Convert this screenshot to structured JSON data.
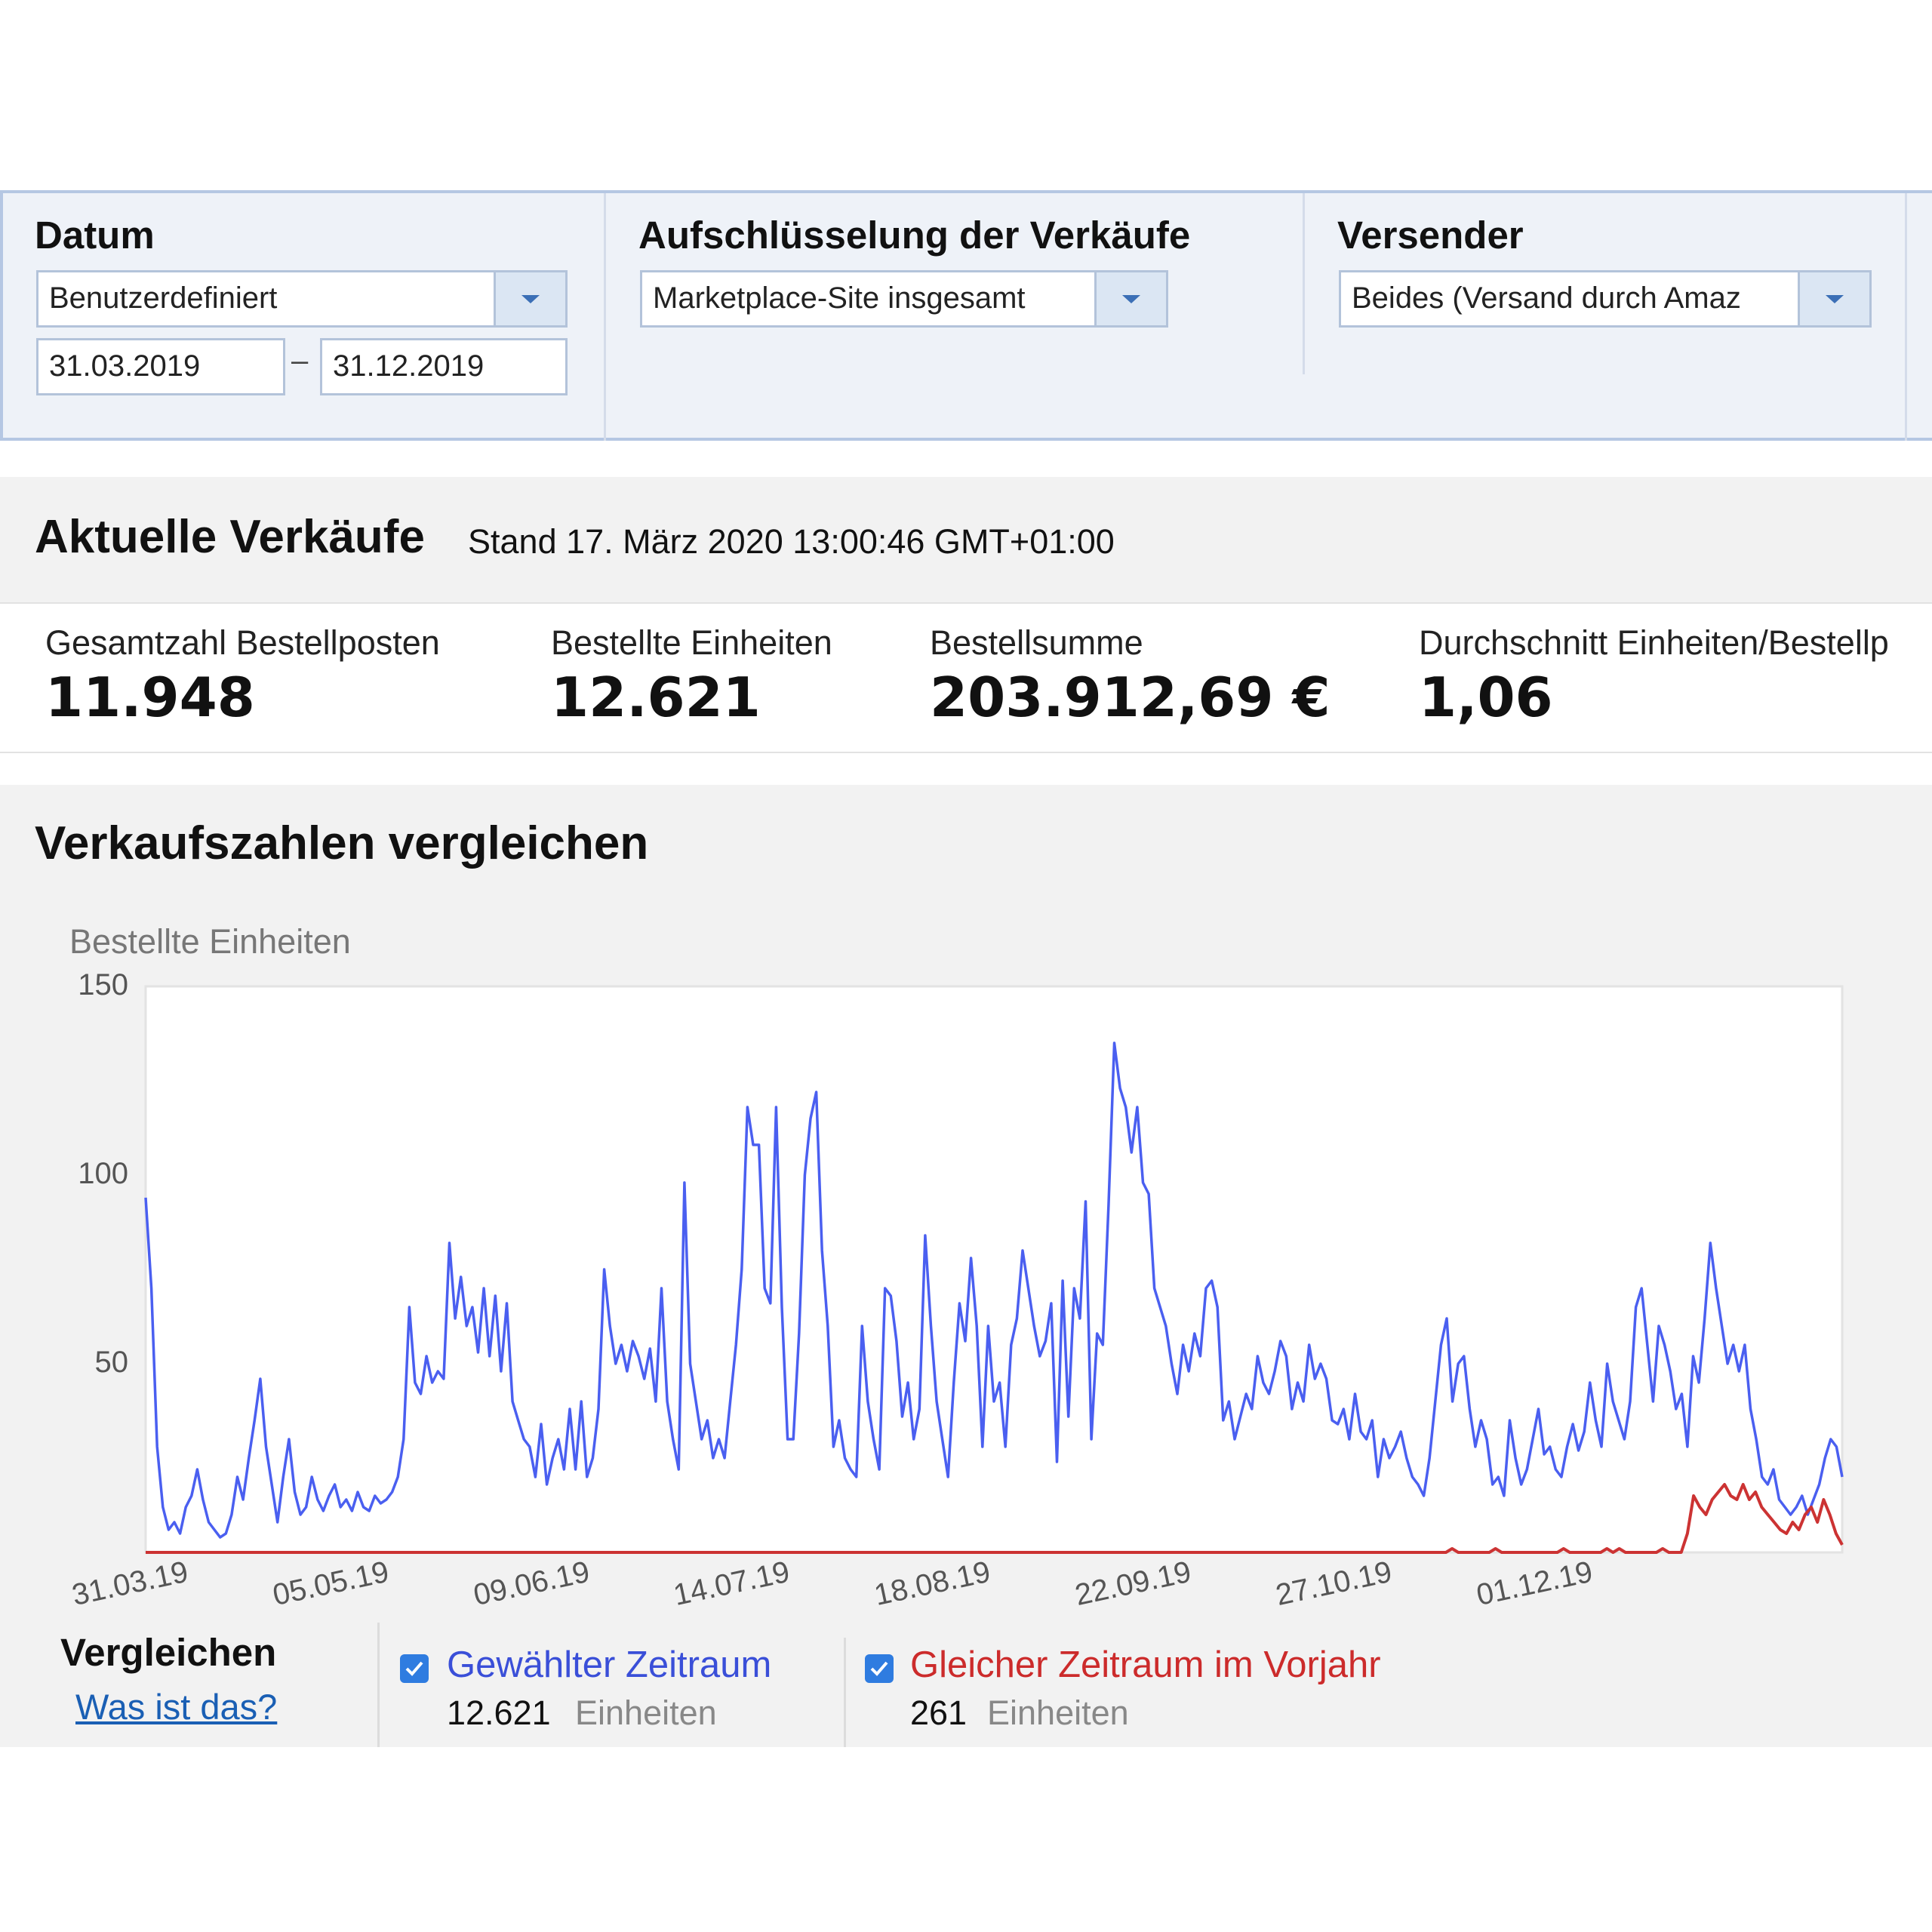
{
  "filters": {
    "datum": {
      "label": "Datum",
      "range_value": "Benutzerdefiniert",
      "start_date": "31.03.2019",
      "separator": "–",
      "end_date": "31.12.2019"
    },
    "aufschluesselung": {
      "label": "Aufschlüsselung der Verkäufe",
      "value": "Marketplace-Site insgesamt"
    },
    "versender": {
      "label": "Versender",
      "value": "Beides (Versand durch Amaz"
    }
  },
  "aktuelle_verkaeufe": {
    "title": "Aktuelle Verkäufe",
    "stand": "Stand 17. März 2020 13:00:46 GMT+01:00",
    "metrics": [
      {
        "label": "Gesamtzahl Bestellposten",
        "value": "11.948"
      },
      {
        "label": "Bestellte Einheiten",
        "value": "12.621"
      },
      {
        "label": "Bestellsumme",
        "value": "203.912,69 €"
      },
      {
        "label": "Durchschnitt Einheiten/Bestellp",
        "value": "1,06"
      }
    ]
  },
  "compare_section": {
    "title": "Verkaufszahlen vergleichen",
    "compare_label": "Vergleichen",
    "help_link": "Was ist das?",
    "legend": [
      {
        "label": "Gewählter Zeitraum",
        "count": "12.621",
        "unit": "Einheiten",
        "checked": true,
        "color": "#3a4fd8"
      },
      {
        "label": "Gleicher Zeitraum im Vorjahr",
        "count": "261",
        "unit": "Einheiten",
        "checked": true,
        "color": "#cc2b2b"
      }
    ]
  },
  "chart_data": {
    "type": "line",
    "ylabel": "Bestellte Einheiten",
    "ylim": [
      0,
      150
    ],
    "yticks": [
      50,
      100,
      150
    ],
    "xtick_labels": [
      "31.03.19",
      "05.05.19",
      "09.06.19",
      "14.07.19",
      "18.08.19",
      "22.09.19",
      "27.10.19",
      "01.12.19"
    ],
    "x_start": "31.03.19",
    "x_end": "31.12.19",
    "grid": false,
    "series": [
      {
        "name": "Gewählter Zeitraum",
        "color": "#4a5ff0",
        "values": [
          94,
          70,
          28,
          12,
          6,
          8,
          5,
          12,
          15,
          22,
          14,
          8,
          6,
          4,
          5,
          10,
          20,
          14,
          25,
          35,
          46,
          28,
          18,
          8,
          20,
          30,
          16,
          10,
          12,
          20,
          14,
          11,
          15,
          18,
          12,
          14,
          11,
          16,
          12,
          11,
          15,
          13,
          14,
          16,
          20,
          30,
          65,
          45,
          42,
          52,
          45,
          48,
          46,
          82,
          62,
          73,
          60,
          65,
          53,
          70,
          52,
          68,
          48,
          66,
          40,
          35,
          30,
          28,
          20,
          34,
          18,
          25,
          30,
          22,
          38,
          22,
          40,
          20,
          25,
          38,
          75,
          60,
          50,
          55,
          48,
          56,
          52,
          46,
          54,
          40,
          70,
          40,
          30,
          22,
          98,
          50,
          40,
          30,
          35,
          25,
          30,
          25,
          40,
          55,
          75,
          118,
          108,
          108,
          70,
          66,
          118,
          65,
          30,
          30,
          58,
          100,
          115,
          122,
          80,
          60,
          28,
          35,
          25,
          22,
          20,
          60,
          40,
          30,
          22,
          70,
          68,
          56,
          36,
          45,
          30,
          38,
          84,
          60,
          40,
          30,
          20,
          45,
          66,
          56,
          78,
          60,
          28,
          60,
          40,
          45,
          28,
          55,
          62,
          80,
          70,
          60,
          52,
          56,
          66,
          24,
          72,
          36,
          70,
          62,
          93,
          30,
          58,
          55,
          92,
          135,
          123,
          118,
          106,
          118,
          98,
          95,
          70,
          65,
          60,
          50,
          42,
          55,
          48,
          58,
          52,
          70,
          72,
          65,
          35,
          40,
          30,
          36,
          42,
          38,
          52,
          45,
          42,
          48,
          56,
          52,
          38,
          45,
          40,
          55,
          46,
          50,
          46,
          35,
          34,
          38,
          30,
          42,
          32,
          30,
          35,
          20,
          30,
          25,
          28,
          32,
          25,
          20,
          18,
          15,
          25,
          40,
          55,
          62,
          40,
          50,
          52,
          38,
          28,
          35,
          30,
          18,
          20,
          15,
          35,
          25,
          18,
          22,
          30,
          38,
          26,
          28,
          22,
          20,
          28,
          34,
          27,
          32,
          45,
          35,
          28,
          50,
          40,
          35,
          30,
          40,
          65,
          70,
          55,
          40,
          60,
          55,
          48,
          38,
          42,
          28,
          52,
          45,
          62,
          82,
          70,
          60,
          50,
          55,
          48,
          55,
          38,
          30,
          20,
          18,
          22,
          14,
          12,
          10,
          12,
          15,
          10,
          14,
          18,
          25,
          30,
          28,
          20
        ]
      },
      {
        "name": "Gleicher Zeitraum im Vorjahr",
        "color": "#cc3333",
        "values": [
          0,
          0,
          0,
          0,
          0,
          0,
          0,
          0,
          0,
          0,
          0,
          0,
          0,
          0,
          0,
          0,
          0,
          0,
          0,
          0,
          0,
          0,
          0,
          0,
          0,
          0,
          0,
          0,
          0,
          0,
          0,
          0,
          0,
          0,
          0,
          0,
          0,
          0,
          0,
          0,
          0,
          0,
          0,
          0,
          0,
          0,
          0,
          0,
          0,
          0,
          0,
          0,
          0,
          0,
          0,
          0,
          0,
          0,
          0,
          0,
          0,
          0,
          0,
          0,
          0,
          0,
          0,
          0,
          0,
          0,
          0,
          0,
          0,
          0,
          0,
          0,
          0,
          0,
          0,
          0,
          0,
          0,
          0,
          0,
          0,
          0,
          0,
          0,
          0,
          0,
          0,
          0,
          0,
          0,
          0,
          0,
          0,
          0,
          0,
          0,
          0,
          0,
          0,
          0,
          0,
          0,
          0,
          0,
          0,
          0,
          0,
          0,
          0,
          0,
          0,
          0,
          0,
          0,
          0,
          0,
          0,
          0,
          0,
          0,
          0,
          0,
          0,
          0,
          0,
          0,
          0,
          0,
          0,
          0,
          0,
          0,
          0,
          0,
          0,
          0,
          0,
          0,
          0,
          0,
          0,
          0,
          0,
          0,
          0,
          0,
          0,
          0,
          0,
          0,
          0,
          0,
          0,
          0,
          0,
          0,
          0,
          0,
          0,
          0,
          0,
          0,
          0,
          0,
          0,
          0,
          0,
          0,
          0,
          0,
          0,
          0,
          0,
          0,
          0,
          0,
          0,
          0,
          0,
          0,
          0,
          0,
          0,
          0,
          0,
          0,
          0,
          0,
          0,
          0,
          0,
          0,
          0,
          0,
          0,
          0,
          0,
          0,
          0,
          0,
          0,
          0,
          0,
          0,
          0,
          0,
          0,
          1,
          0,
          0,
          0,
          0,
          0,
          0,
          1,
          0,
          0,
          0,
          0,
          0,
          0,
          0,
          0,
          0,
          0,
          1,
          0,
          0,
          0,
          0,
          0,
          0,
          1,
          0,
          1,
          0,
          0,
          0,
          0,
          0,
          0,
          1,
          0,
          0,
          0,
          5,
          15,
          12,
          10,
          14,
          16,
          18,
          15,
          14,
          18,
          14,
          16,
          12,
          10,
          8,
          6,
          5,
          8,
          6,
          10,
          12,
          8,
          14,
          10,
          5,
          2
        ]
      }
    ]
  }
}
